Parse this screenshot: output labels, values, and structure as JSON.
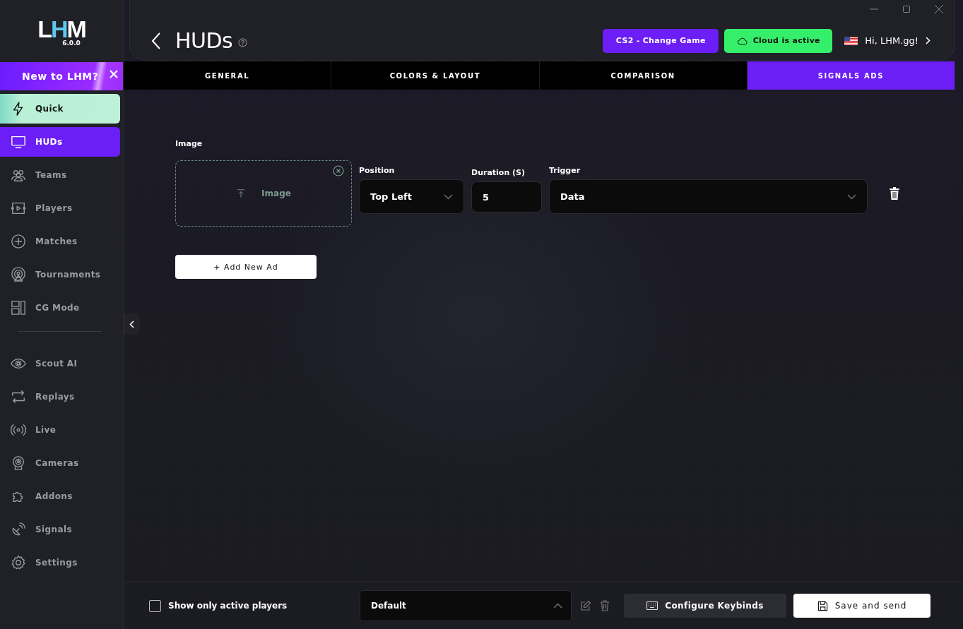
{
  "logo": {
    "letters": [
      {
        "char": "L",
        "accent": false
      },
      {
        "char": "H",
        "accent": true
      },
      {
        "char": "M",
        "accent": false
      }
    ],
    "version": "6.0.0"
  },
  "banner": {
    "text": "New to LHM?"
  },
  "sidebar": {
    "groups": [
      {
        "items": [
          {
            "label": "Quick",
            "kind": "quick",
            "selected": false
          },
          {
            "label": "HUDs",
            "kind": "link",
            "selected": true
          },
          {
            "label": "Teams",
            "kind": "link",
            "selected": false
          },
          {
            "label": "Players",
            "kind": "link",
            "selected": false
          },
          {
            "label": "Matches",
            "kind": "link",
            "selected": false
          },
          {
            "label": "Tournaments",
            "kind": "link",
            "selected": false
          },
          {
            "label": "CG Mode",
            "kind": "link",
            "selected": false
          }
        ]
      },
      {
        "items": [
          {
            "label": "Scout AI",
            "kind": "link",
            "selected": false
          },
          {
            "label": "Replays",
            "kind": "link",
            "selected": false
          },
          {
            "label": "Live",
            "kind": "link",
            "selected": false
          },
          {
            "label": "Cameras",
            "kind": "link",
            "selected": false
          },
          {
            "label": "Addons",
            "kind": "link",
            "selected": false
          },
          {
            "label": "Signals",
            "kind": "link",
            "selected": false
          },
          {
            "label": "Settings",
            "kind": "link",
            "selected": false
          }
        ]
      }
    ]
  },
  "header": {
    "title": "HUDs",
    "game_button": "CS2 - Change Game",
    "cloud_button": "Cloud is active",
    "user": "Hi, LHM.gg!"
  },
  "tabs": [
    {
      "label": "GENERAL",
      "selected": false
    },
    {
      "label": "COLORS & LAYOUT",
      "selected": false
    },
    {
      "label": "COMPARISON",
      "selected": false
    },
    {
      "label": "SIGNALS ADS",
      "selected": true
    }
  ],
  "ads": {
    "section_label": "Image",
    "rows": [
      {
        "upload_label": "Image",
        "position_label": "Position",
        "position": "Top Left",
        "duration_label": "Duration (S)",
        "duration": "5",
        "trigger_label": "Trigger",
        "trigger": "Data"
      }
    ],
    "add_button": "+ Add New Ad"
  },
  "footer": {
    "checkbox": {
      "label": "Show only active players",
      "checked": false
    },
    "preset": "Default",
    "keybinds_button": "Configure Keybinds",
    "save_button": "Save and send"
  }
}
